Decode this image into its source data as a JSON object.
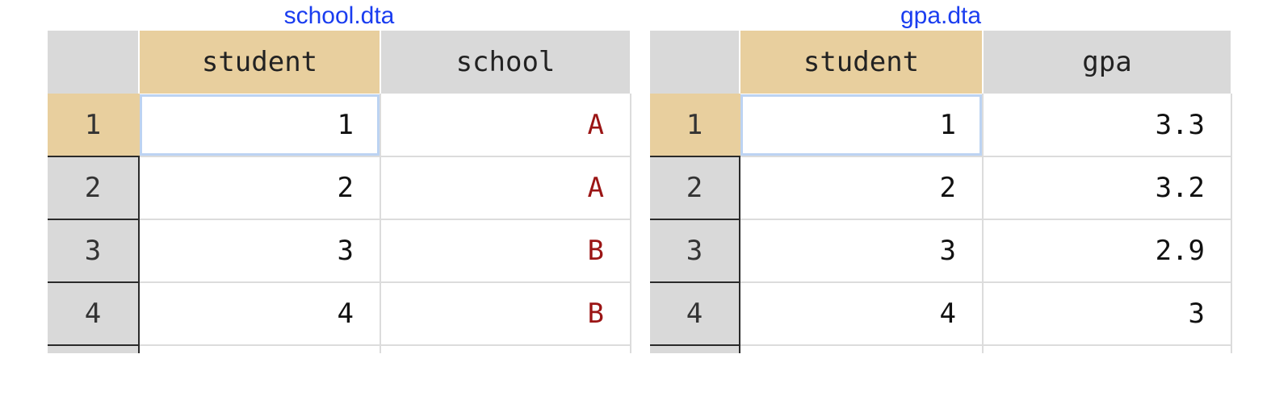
{
  "left": {
    "title": "school.dta",
    "columns": [
      "student",
      "school"
    ],
    "rows": [
      {
        "num": "1",
        "student": "1",
        "value": "A"
      },
      {
        "num": "2",
        "student": "2",
        "value": "A"
      },
      {
        "num": "3",
        "student": "3",
        "value": "B"
      },
      {
        "num": "4",
        "student": "4",
        "value": "B"
      }
    ]
  },
  "right": {
    "title": "gpa.dta",
    "columns": [
      "student",
      "gpa"
    ],
    "rows": [
      {
        "num": "1",
        "student": "1",
        "value": "3.3"
      },
      {
        "num": "2",
        "student": "2",
        "value": "3.2"
      },
      {
        "num": "3",
        "student": "3",
        "value": "2.9"
      },
      {
        "num": "4",
        "student": "4",
        "value": "3"
      }
    ]
  },
  "colors": {
    "title": "#1a3df0",
    "header_bg": "#d9d9d9",
    "highlight_bg": "#e8cf9e",
    "string_value": "#9b1515",
    "active_cell_border": "#bcd3f2"
  }
}
